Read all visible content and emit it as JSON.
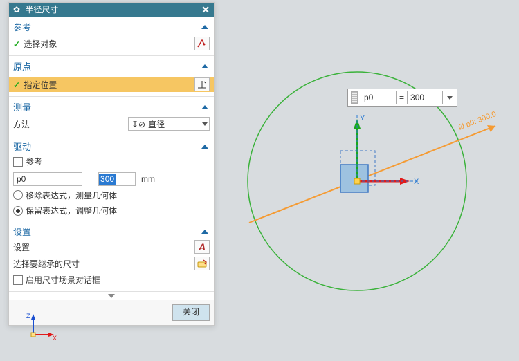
{
  "panel": {
    "title": "半径尺寸",
    "sections": {
      "ref": {
        "title": "参考",
        "selectObj": "选择对象"
      },
      "origin": {
        "title": "原点",
        "specifyPos": "指定位置"
      },
      "measure": {
        "title": "测量",
        "methodLabel": "方法",
        "methodValue": "直径"
      },
      "drive": {
        "title": "驱动",
        "refChk": "参考",
        "expr": "p0",
        "eq": "=",
        "value": "300",
        "unit": "mm",
        "opt1": "移除表达式，测量几何体",
        "opt2": "保留表达式，调整几何体"
      },
      "settings": {
        "title": "设置",
        "row1": "设置",
        "row2": "选择要继承的尺寸",
        "chk": "启用尺寸场景对话框"
      }
    },
    "closeBtn": "关闭"
  },
  "floating": {
    "name": "p0",
    "eq": "=",
    "value": "300"
  },
  "axes": {
    "x": "X",
    "y": "Y"
  },
  "dimLabel": "Ø p0: 300.0",
  "triad": {
    "x": "X",
    "z": "Z"
  },
  "colors": {
    "circle": "#3ab23a",
    "dim": "#f59b33",
    "xaxis": "#e11a1a",
    "yaxis": "#1aa81a",
    "zaxis": "#1a4fd0",
    "rect": "#8fb6d9",
    "rectStroke": "#3f78c4"
  }
}
